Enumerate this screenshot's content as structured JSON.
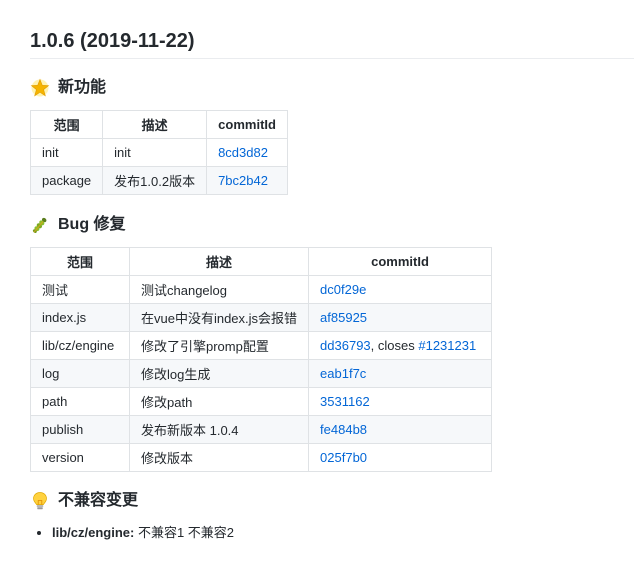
{
  "release": {
    "title": "1.0.6 (2019-11-22)"
  },
  "features": {
    "heading": "新功能",
    "icon": "sparkle-star-icon",
    "headers": [
      "范围",
      "描述",
      "commitId"
    ],
    "rows": [
      {
        "scope": "init",
        "desc": "init",
        "commit": "8cd3d82"
      },
      {
        "scope": "package",
        "desc": "发布1.0.2版本",
        "commit": "7bc2b42"
      }
    ]
  },
  "bugfixes": {
    "heading": "Bug 修复",
    "icon": "bug-icon",
    "headers": [
      "范围",
      "描述",
      "commitId"
    ],
    "rows": [
      {
        "scope": "测试",
        "desc": "测试changelog",
        "commit": "dc0f29e"
      },
      {
        "scope": "index.js",
        "desc": "在vue中没有index.js会报错",
        "commit": "af85925"
      },
      {
        "scope": "lib/cz/engine",
        "desc": "修改了引擎promp配置",
        "commit": "dd36793",
        "closes_text": ", closes ",
        "closes_ref": "#1231231"
      },
      {
        "scope": "log",
        "desc": "修改log生成",
        "commit": "eab1f7c"
      },
      {
        "scope": "path",
        "desc": "修改path",
        "commit": "3531162"
      },
      {
        "scope": "publish",
        "desc": "发布新版本 1.0.4",
        "commit": "fe484b8"
      },
      {
        "scope": "version",
        "desc": "修改版本",
        "commit": "025f7b0"
      }
    ]
  },
  "breaking": {
    "heading": "不兼容变更",
    "icon": "lightbulb-icon",
    "items": [
      {
        "scope": "lib/cz/engine:",
        "text": " 不兼容1 不兼容2"
      }
    ]
  },
  "colors": {
    "link": "#0366d6",
    "border": "#dfe2e5",
    "stripe": "#f6f8fa"
  }
}
